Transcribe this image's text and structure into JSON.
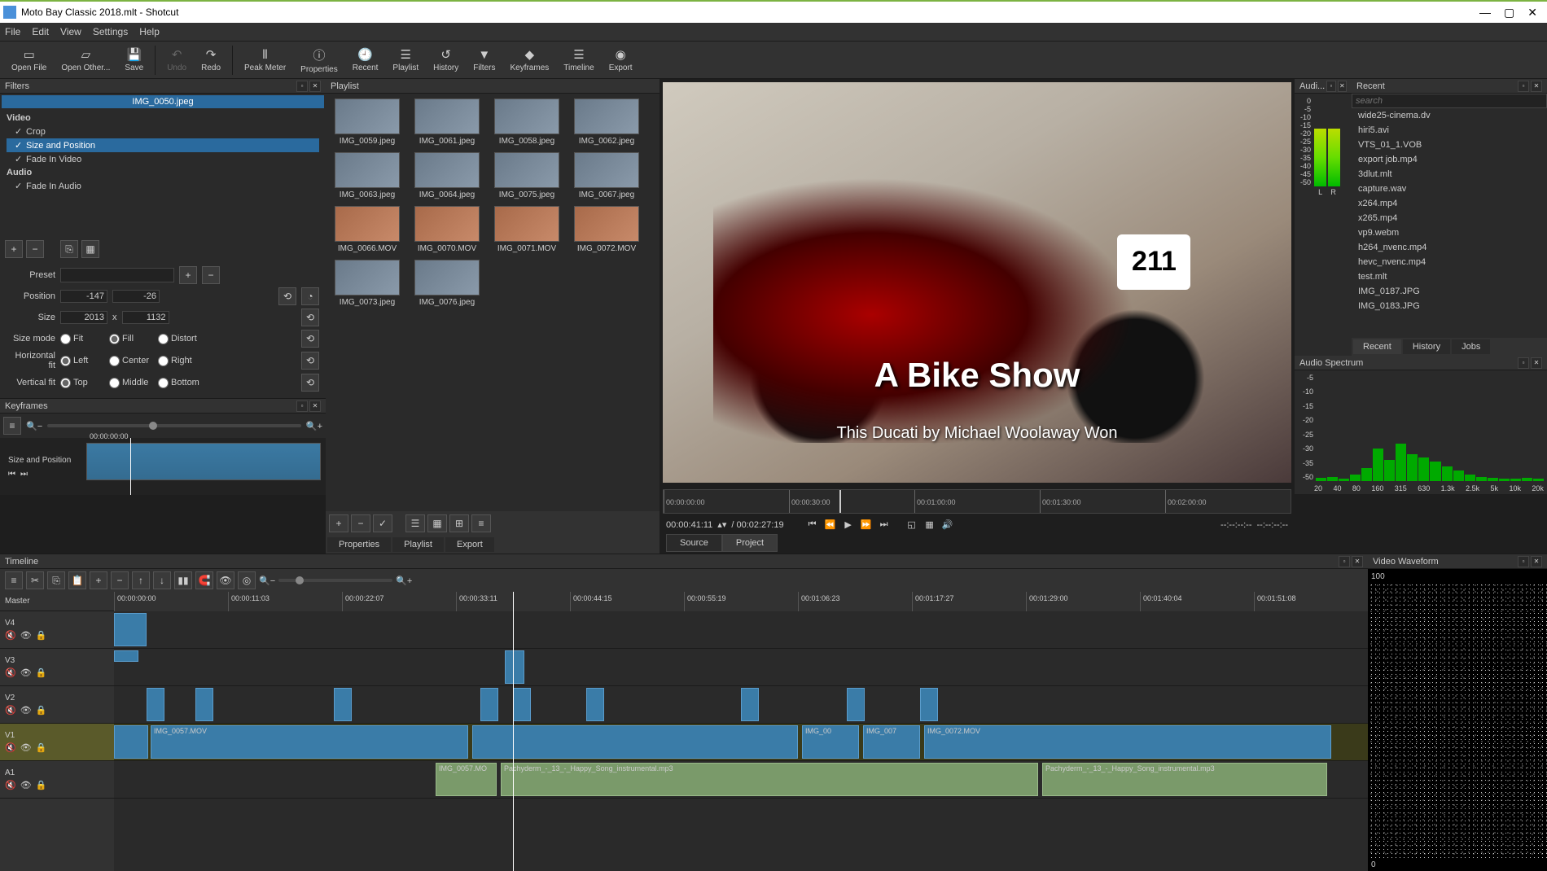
{
  "window": {
    "title": "Moto Bay Classic 2018.mlt - Shotcut"
  },
  "menu": [
    "File",
    "Edit",
    "View",
    "Settings",
    "Help"
  ],
  "toolbar": [
    {
      "label": "Open File",
      "icon": "▭"
    },
    {
      "label": "Open Other...",
      "icon": "▱"
    },
    {
      "label": "Save",
      "icon": "💾",
      "sep": true
    },
    {
      "label": "Undo",
      "icon": "↶",
      "disabled": true
    },
    {
      "label": "Redo",
      "icon": "↷",
      "sep": true
    },
    {
      "label": "Peak Meter",
      "icon": "⫴"
    },
    {
      "label": "Properties",
      "icon": "ⓘ"
    },
    {
      "label": "Recent",
      "icon": "🕘"
    },
    {
      "label": "Playlist",
      "icon": "☰"
    },
    {
      "label": "History",
      "icon": "↺"
    },
    {
      "label": "Filters",
      "icon": "▼"
    },
    {
      "label": "Keyframes",
      "icon": "◆"
    },
    {
      "label": "Timeline",
      "icon": "☰"
    },
    {
      "label": "Export",
      "icon": "◉"
    }
  ],
  "filters": {
    "panel": "Filters",
    "clip": "IMG_0050.jpeg",
    "video_hdr": "Video",
    "audio_hdr": "Audio",
    "video": [
      {
        "name": "Crop",
        "chk": true,
        "sel": false
      },
      {
        "name": "Size and Position",
        "chk": true,
        "sel": true
      },
      {
        "name": "Fade In Video",
        "chk": true,
        "sel": false
      }
    ],
    "audio": [
      {
        "name": "Fade In Audio",
        "chk": true,
        "sel": false
      }
    ],
    "preset_lbl": "Preset",
    "position": {
      "lbl": "Position",
      "x": "-147",
      "y": "-26"
    },
    "size": {
      "lbl": "Size",
      "w": "2013",
      "x": "x",
      "h": "1132"
    },
    "sizemode": {
      "lbl": "Size mode",
      "opts": [
        "Fit",
        "Fill",
        "Distort"
      ],
      "sel": "Fill"
    },
    "hfit": {
      "lbl": "Horizontal fit",
      "opts": [
        "Left",
        "Center",
        "Right"
      ],
      "sel": "Left"
    },
    "vfit": {
      "lbl": "Vertical fit",
      "opts": [
        "Top",
        "Middle",
        "Bottom"
      ],
      "sel": "Top"
    }
  },
  "keyframes": {
    "panel": "Keyframes",
    "filter": "Size and Position",
    "time": "00:00:00:00"
  },
  "playlist": {
    "panel": "Playlist",
    "items": [
      "IMG_0059.jpeg",
      "IMG_0061.jpeg",
      "IMG_0058.jpeg",
      "IMG_0062.jpeg",
      "IMG_0063.jpeg",
      "IMG_0064.jpeg",
      "IMG_0075.jpeg",
      "IMG_0067.jpeg",
      "IMG_0066.MOV",
      "IMG_0070.MOV",
      "IMG_0071.MOV",
      "IMG_0072.MOV",
      "IMG_0073.jpeg",
      "IMG_0076.jpeg"
    ],
    "tabs": [
      "Properties",
      "Playlist",
      "Export"
    ]
  },
  "preview": {
    "plate": "211",
    "title1": "A Bike Show",
    "title2": "This Ducati by Michael Woolaway Won",
    "ruler": [
      "00:00:00:00",
      "00:00:30:00",
      "00:01:00:00",
      "00:01:30:00",
      "00:02:00:00"
    ],
    "current": "00:00:41:11",
    "total": "/ 00:02:27:19",
    "incode": "--:--:--:--",
    "outcode": "--:--:--:--",
    "tabs": [
      "Source",
      "Project"
    ]
  },
  "recent": {
    "panel": "Recent",
    "placeholder": "search",
    "items": [
      "wide25-cinema.dv",
      "hiri5.avi",
      "VTS_01_1.VOB",
      "export job.mp4",
      "3dlut.mlt",
      "capture.wav",
      "x264.mp4",
      "x265.mp4",
      "vp9.webm",
      "h264_nvenc.mp4",
      "hevc_nvenc.mp4",
      "test.mlt",
      "IMG_0187.JPG",
      "IMG_0183.JPG"
    ],
    "tabs": [
      "Recent",
      "History",
      "Jobs"
    ]
  },
  "audio_meter": {
    "panel": "Audi...",
    "scale": [
      "0",
      "-5",
      "-10",
      "-15",
      "-20",
      "-25",
      "-30",
      "-35",
      "-40",
      "-45",
      "-50"
    ],
    "L": "L",
    "R": "R"
  },
  "audio_spectrum": {
    "panel": "Audio Spectrum",
    "scale": [
      "-5",
      "-10",
      "-15",
      "-20",
      "-25",
      "-30",
      "-35",
      "-50"
    ],
    "freq": [
      "20",
      "40",
      "80",
      "160",
      "315",
      "630",
      "1.3k",
      "2.5k",
      "5k",
      "10k",
      "20k"
    ]
  },
  "timeline": {
    "panel": "Timeline",
    "ruler": [
      "00:00:00:00",
      "00:00:11:03",
      "00:00:22:07",
      "00:00:33:11",
      "00:00:44:15",
      "00:00:55:19",
      "00:01:06:23",
      "00:01:17:27",
      "00:01:29:00",
      "00:01:40:04",
      "00:01:51:08"
    ],
    "tracks": [
      "Master",
      "V4",
      "V3",
      "V2",
      "V1",
      "A1"
    ],
    "v1clip": "IMG_0057.MOV",
    "v1clip2": "IMG_00",
    "v1clip3": "IMG_007",
    "v1clip4": "IMG_0072.MOV",
    "a1clip": "IMG_0057.MO",
    "a1clip2": "Pachyderm_-_13_-_Happy_Song_instrumental.mp3",
    "a1clip3": "Pachyderm_-_13_-_Happy_Song_instrumental.mp3"
  },
  "waveform": {
    "panel": "Video Waveform",
    "top": "100",
    "bottom": "0"
  }
}
